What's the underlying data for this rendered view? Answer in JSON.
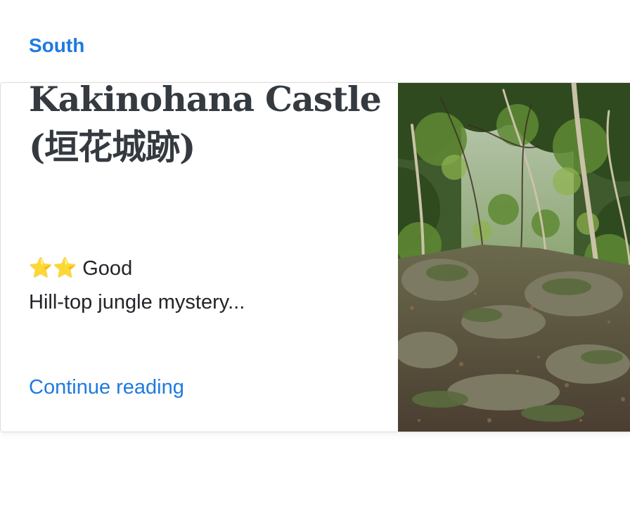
{
  "card": {
    "category": "South",
    "title": "Kakinohana Castle (垣花城跡)",
    "rating": {
      "stars": "⭐⭐",
      "star_count": 2,
      "label": "Good"
    },
    "excerpt": "Hill-top jungle mystery...",
    "continue_label": "Continue reading",
    "image": {
      "icon": "photo-jungle-ruins-icon"
    }
  },
  "colors": {
    "accent": "#1f7ae0",
    "title": "#343a40",
    "text": "#212529",
    "star": "#f6b800"
  }
}
